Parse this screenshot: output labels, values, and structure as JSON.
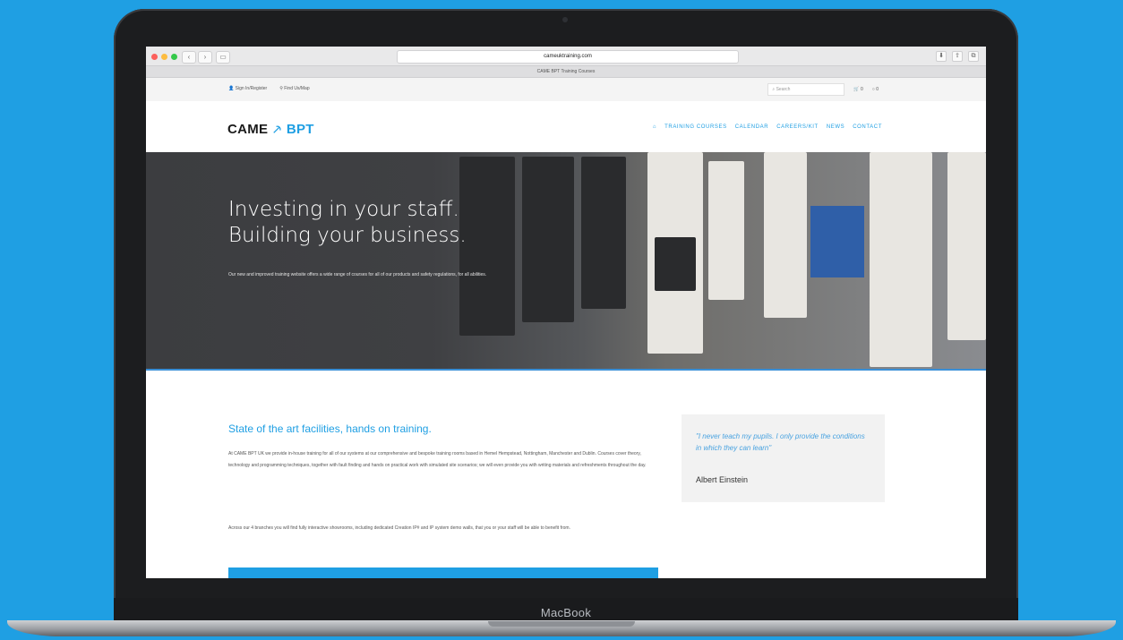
{
  "device": {
    "label": "MacBook"
  },
  "browser": {
    "url": "cameuktraining.com",
    "tab_title": "CAME BPT Training Courses"
  },
  "utility_bar": {
    "links": [
      "Sign In/Register",
      "Find Us/Map"
    ],
    "search_placeholder": "Search",
    "cart_count": "0",
    "account_count": "0"
  },
  "site": {
    "logo_left": "CAME",
    "logo_right": "BPT",
    "nav": [
      "TRAINING COURSES",
      "CALENDAR",
      "CAREERS/KIT",
      "NEWS",
      "CONTACT"
    ]
  },
  "hero": {
    "title_line1": "Investing in your staff.",
    "title_line2": "Building your business.",
    "subtitle": "Our new and improved training website offers a wide range of courses for all of our products and safety regulations, for all abilities."
  },
  "content": {
    "section_title": "State of the art facilities, hands on training.",
    "paragraph1": "At CAME BPT UK we provide in-house training for all of our systems at our comprehensive and bespoke training rooms based in Hemel Hempstead, Nottingham, Manchester and Dublin. Courses cover theory, technology and programming techniques, together with fault finding and hands on practical work with simulated site scenarios; we will even provide you with writing materials and refreshments throughout the day.",
    "paragraph2": "Across our 4 branches you will find fully interactive showrooms, including dedicated Creation IP# and IP system demo walls, that you or your staff will be able to benefit from."
  },
  "quote": {
    "text": "\"I never teach my pupils. I only provide the conditions in which they can learn\"",
    "author": "Albert Einstein"
  },
  "colors": {
    "accent": "#1f9fe3",
    "background": "#1f9fe3"
  }
}
